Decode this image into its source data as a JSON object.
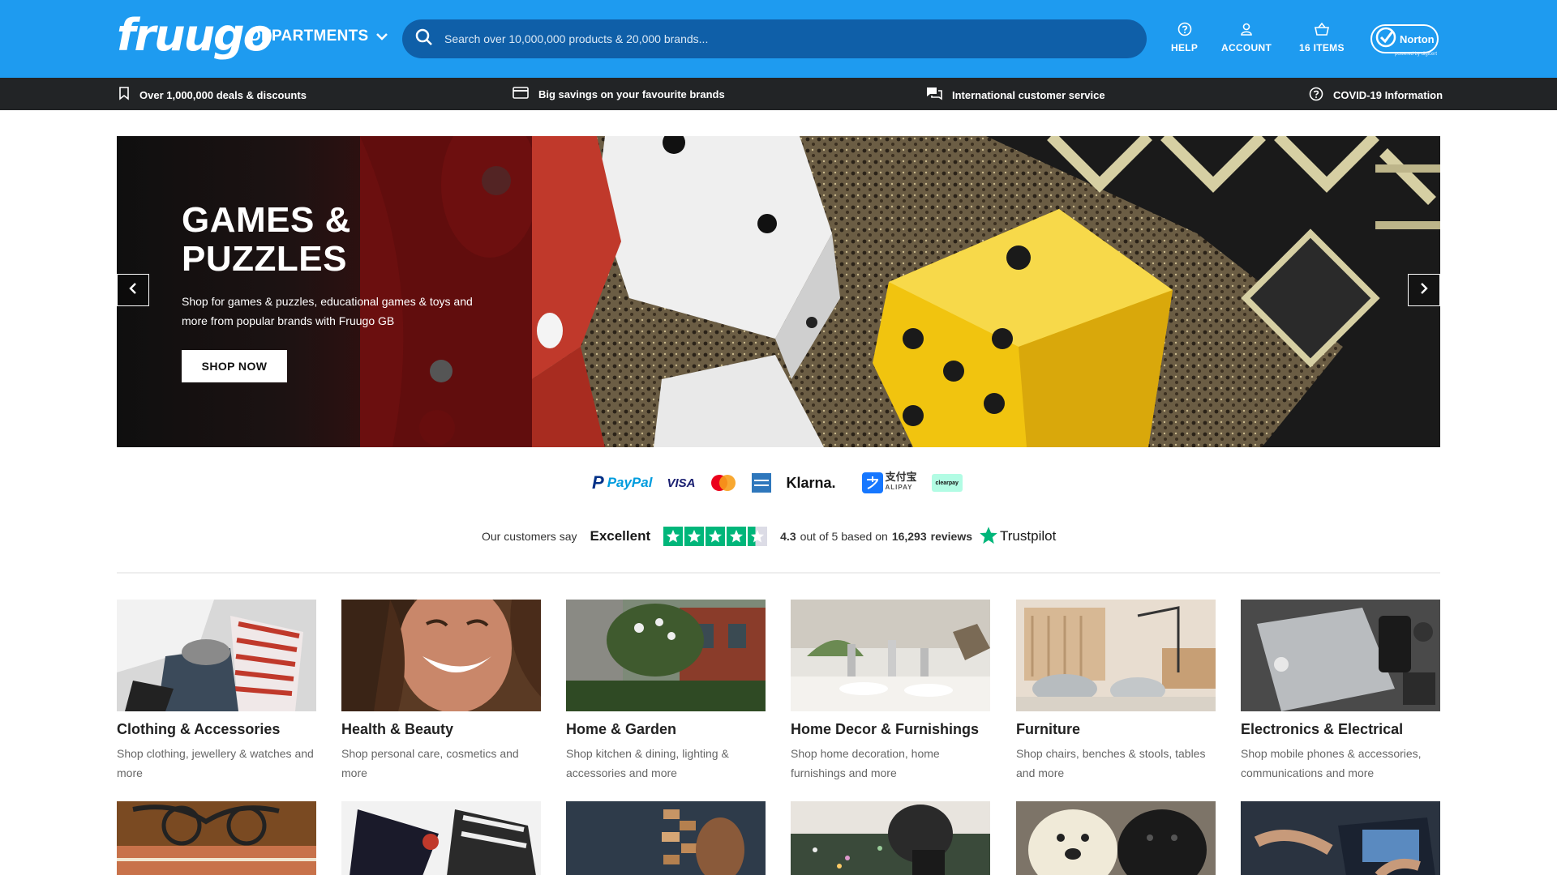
{
  "header": {
    "logo": "fruugo",
    "departments_label": "DEPARTMENTS",
    "search_placeholder": "Search over 10,000,000 products & 20,000 brands...",
    "help_label": "HELP",
    "account_label": "ACCOUNT",
    "basket_label": "16 ITEMS",
    "norton_label": "Norton",
    "norton_sub": "powered by digicert"
  },
  "strip": {
    "deals": "Over 1,000,000 deals & discounts",
    "savings": "Big savings on your favourite brands",
    "service": "International customer service",
    "covid": "COVID-19 Information"
  },
  "hero": {
    "title": "GAMES & PUZZLES",
    "description": "Shop for games & puzzles, educational games & toys and more from popular brands with Fruugo GB",
    "cta": "SHOP NOW"
  },
  "payments": {
    "paypal": "PayPal",
    "visa": "VISA",
    "klarna": "Klarna.",
    "alipay_cn": "支付宝",
    "alipay": "ALIPAY",
    "clearpay": "clearpay"
  },
  "trustpilot": {
    "prefix": "Our customers say",
    "rating_word": "Excellent",
    "score": "4.3",
    "out_of": "out of 5 based on",
    "count": "16,293",
    "reviews": "reviews",
    "brand": "Trustpilot",
    "stars": 4.3
  },
  "categories": [
    {
      "title": "Clothing & Accessories",
      "desc": "Shop clothing, jewellery & watches and more"
    },
    {
      "title": "Health & Beauty",
      "desc": "Shop personal care, cosmetics and more"
    },
    {
      "title": "Home & Garden",
      "desc": "Shop kitchen & dining, lighting & accessories and more"
    },
    {
      "title": "Home Decor & Furnishings",
      "desc": "Shop home decoration, home furnishings and more"
    },
    {
      "title": "Furniture",
      "desc": "Shop chairs, benches & stools, tables and more"
    },
    {
      "title": "Electronics & Electrical",
      "desc": "Shop mobile phones & accessories, communications and more"
    }
  ],
  "colors": {
    "header_bg": "#1e9bf0",
    "search_bg": "#0f5fa8",
    "strip_bg": "#222426",
    "trust_green": "#00b67a"
  }
}
